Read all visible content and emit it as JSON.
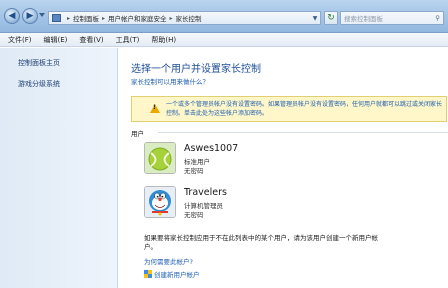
{
  "window": {
    "breadcrumb": [
      "控制面板",
      "用户帐户和家庭安全",
      "家长控制"
    ],
    "search_placeholder": "搜索控制面板"
  },
  "menu": [
    "文件(F)",
    "编辑(E)",
    "查看(V)",
    "工具(T)",
    "帮助(H)"
  ],
  "sidebar": {
    "items": [
      {
        "label": "控制面板主页"
      },
      {
        "label": "游戏分级系统"
      }
    ]
  },
  "main": {
    "title": "选择一个用户并设置家长控制",
    "help_link": "家长控制可以用来做什么？",
    "warning": "一个或多个管理员帐户没有设置密码。如果管理员帐户没有设置密码，任何用户就都可以跳过或关闭家长控制。单击此处为这些帐户添加密码。",
    "users_label": "用户",
    "users": [
      {
        "name": "Aswes1007",
        "role": "标准用户",
        "password": "无密码"
      },
      {
        "name": "Travelers",
        "role": "计算机管理员",
        "password": "无密码"
      }
    ],
    "note": "如果要将家长控制应用于不在此列表中的某个用户，请为该用户创建一个新用户帐户。",
    "why_link": "为何需要此帐户?",
    "create_link": "创建新用户帐户"
  },
  "colors": {
    "title_blue": "#1e4e96",
    "link_blue": "#1f5fb2",
    "warning_bg": "#fff7c9"
  }
}
